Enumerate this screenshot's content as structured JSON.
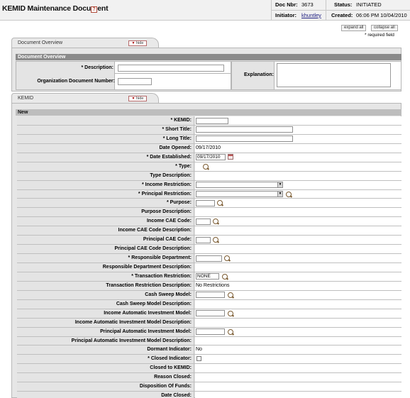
{
  "header": {
    "title": "KEMID Maintenance Document",
    "help_glyph": "?",
    "doc_nbr_label": "Doc Nbr:",
    "doc_nbr_value": "3673",
    "status_label": "Status:",
    "status_value": "INITIATED",
    "initiator_label": "Initiator:",
    "initiator_value": "khuntley",
    "created_label": "Created:",
    "created_value": "06:06 PM 10/04/2010"
  },
  "controls": {
    "expand_all": "expand all",
    "collapse_all": "collapse all",
    "required_note": "* required field"
  },
  "document_overview": {
    "tab_label": "Document Overview",
    "hide_label": "hide",
    "section_title": "Document Overview",
    "description_label": "* Description:",
    "org_doc_number_label": "Organization Document Number:",
    "explanation_label": "Explanation:",
    "description_value": "",
    "org_doc_number_value": "",
    "explanation_value": ""
  },
  "kemid": {
    "tab_label": "KEMID",
    "hide_label": "hide",
    "section_title": "New",
    "rows": [
      {
        "label": "* KEMID:",
        "value": ""
      },
      {
        "label": "* Short Title:",
        "value": ""
      },
      {
        "label": "* Long Title:",
        "value": ""
      },
      {
        "label": "Date Opened:",
        "value": "09/17/2010"
      },
      {
        "label": "* Date Established:",
        "value": "09/17/2010"
      },
      {
        "label": "* Type:",
        "value": ""
      },
      {
        "label": "Type Description:",
        "value": ""
      },
      {
        "label": "* Income Restriction:",
        "value": ""
      },
      {
        "label": "* Principal Restriction:",
        "value": ""
      },
      {
        "label": "* Purpose:",
        "value": ""
      },
      {
        "label": "Purpose Description:",
        "value": ""
      },
      {
        "label": "Income CAE Code:",
        "value": ""
      },
      {
        "label": "Income CAE Code Description:",
        "value": ""
      },
      {
        "label": "Principal CAE Code:",
        "value": ""
      },
      {
        "label": "Principal CAE Code Description:",
        "value": ""
      },
      {
        "label": "* Responsible Department:",
        "value": ""
      },
      {
        "label": "Responsible Department Description:",
        "value": ""
      },
      {
        "label": "* Transaction Restriction:",
        "value": "NONE"
      },
      {
        "label": "Transaction Restriction Description:",
        "value": "No Restrictions"
      },
      {
        "label": "Cash Sweep Model:",
        "value": ""
      },
      {
        "label": "Cash Sweep Model Description:",
        "value": ""
      },
      {
        "label": "Income Automatic Investment Model:",
        "value": ""
      },
      {
        "label": "Income Automatic Investment Model Description:",
        "value": ""
      },
      {
        "label": "Principal Automatic Investment Model:",
        "value": ""
      },
      {
        "label": "Principal Automatic Investment Model Description:",
        "value": ""
      },
      {
        "label": "Dormant Indicator:",
        "value": "No"
      },
      {
        "label": "* Closed Indicator:",
        "value": ""
      },
      {
        "label": "Closed to KEMID:",
        "value": ""
      },
      {
        "label": "Reason Closed:",
        "value": ""
      },
      {
        "label": "Disposition Of Funds:",
        "value": ""
      },
      {
        "label": "Date Closed:",
        "value": ""
      }
    ]
  }
}
